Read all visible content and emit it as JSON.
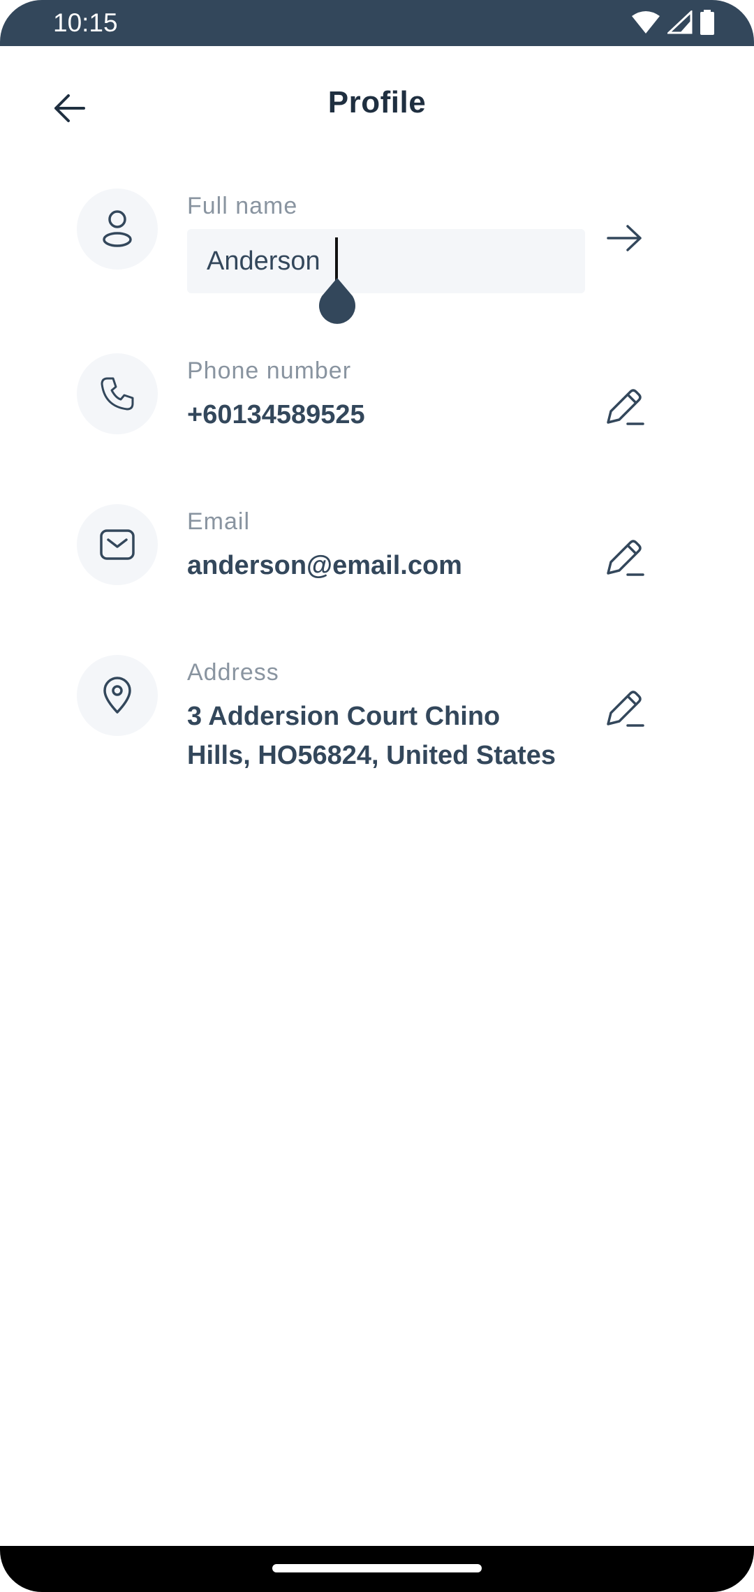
{
  "status_bar": {
    "time": "10:15"
  },
  "header": {
    "title": "Profile"
  },
  "fields": {
    "full_name": {
      "label": "Full name",
      "value": "Anderson"
    },
    "phone": {
      "label": "Phone number",
      "value": "+60134589525"
    },
    "email": {
      "label": "Email",
      "value": "anderson@email.com"
    },
    "address": {
      "label": "Address",
      "line1": "3 Addersion Court Chino",
      "line2": "Hills, HO56824, United States"
    }
  },
  "icons": {
    "back": "arrow-left-icon",
    "user": "user-icon",
    "phone": "phone-icon",
    "email": "mail-icon",
    "address": "map-pin-icon",
    "submit": "arrow-right-icon",
    "edit": "pencil-icon"
  },
  "colors": {
    "primary": "#33475b",
    "label": "#8994a0",
    "icon_bg": "#f4f6f9"
  }
}
